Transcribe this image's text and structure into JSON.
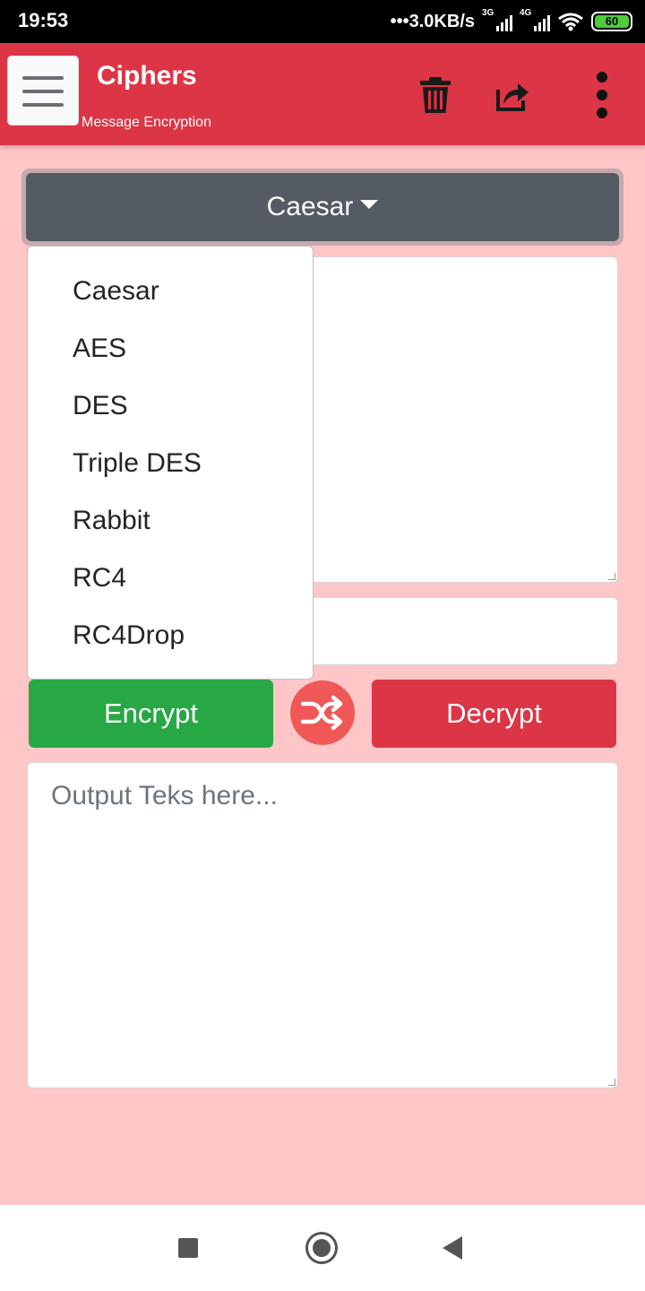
{
  "status_bar": {
    "time": "19:53",
    "network_speed": "•••3.0KB/s",
    "sim1_type": "3G",
    "sim2_type": "4G",
    "battery_level": "60",
    "battery_color": "#4ccd3a"
  },
  "header": {
    "title": "Ciphers",
    "subtitle": "Message Encryption",
    "bg_color": "#dc3545",
    "icons": [
      "menu-icon",
      "trash-icon",
      "share-icon",
      "more-vertical-icon"
    ]
  },
  "cipher_select": {
    "selected": "Caesar",
    "options": [
      "Caesar",
      "AES",
      "DES",
      "Triple DES",
      "Rabbit",
      "RC4",
      "RC4Drop"
    ]
  },
  "inputs": {
    "message_value": "",
    "key_value": "",
    "output_placeholder": "Output Teks here..."
  },
  "actions": {
    "encrypt_label": "Encrypt",
    "decrypt_label": "Decrypt",
    "encrypt_color": "#28a745",
    "decrypt_color": "#dc3545",
    "swap_icon": "shuffle-icon"
  },
  "nav_bar": {
    "icons": [
      "recents-square-icon",
      "home-circle-icon",
      "back-triangle-icon"
    ]
  }
}
